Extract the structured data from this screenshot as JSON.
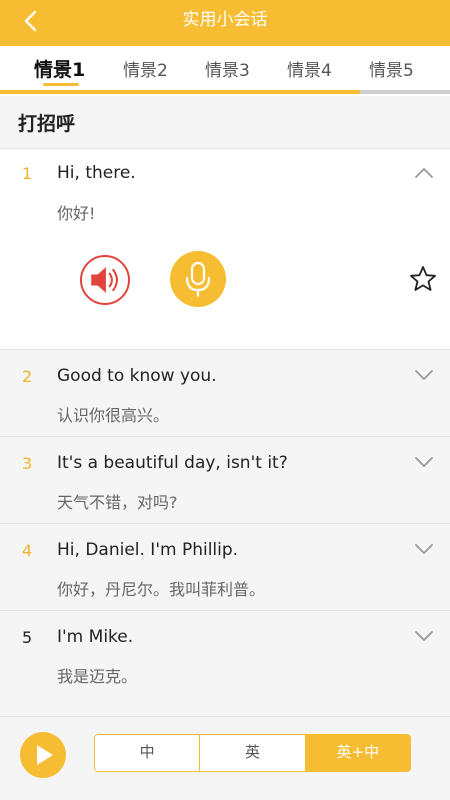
{
  "colors": {
    "accent": "#f7bd32",
    "speaker_red": "#e0453c",
    "number_gold": "#f0b429"
  },
  "header": {
    "title": "实用小会话",
    "back_icon": "chevron-left-icon"
  },
  "tabs": [
    {
      "label": "情景1",
      "active": true
    },
    {
      "label": "情景2",
      "active": false
    },
    {
      "label": "情景3",
      "active": false
    },
    {
      "label": "情景4",
      "active": false
    },
    {
      "label": "情景5",
      "active": false
    }
  ],
  "section": {
    "title": "打招呼"
  },
  "dialogs": [
    {
      "num": "1",
      "en": "Hi, there.",
      "zh": "你好!",
      "expanded": true
    },
    {
      "num": "2",
      "en": "Good to know you.",
      "zh": "认识你很高兴。",
      "expanded": false
    },
    {
      "num": "3",
      "en": "It's a beautiful day, isn't it?",
      "zh": "天气不错，对吗?",
      "expanded": false
    },
    {
      "num": "4",
      "en": "Hi, Daniel. I'm Phillip.",
      "zh": "你好，丹尼尔。我叫菲利普。",
      "expanded": false
    },
    {
      "num": "5",
      "en": "I'm Mike.",
      "zh": "我是迈克。",
      "expanded": false
    }
  ],
  "expanded_controls": {
    "speaker_icon": "speaker-icon",
    "mic_icon": "microphone-icon",
    "star_icon": "star-icon"
  },
  "bottom": {
    "play_icon": "play-icon",
    "modes": [
      {
        "label": "中",
        "active": false
      },
      {
        "label": "英",
        "active": false
      },
      {
        "label": "英+中",
        "active": true
      }
    ]
  }
}
